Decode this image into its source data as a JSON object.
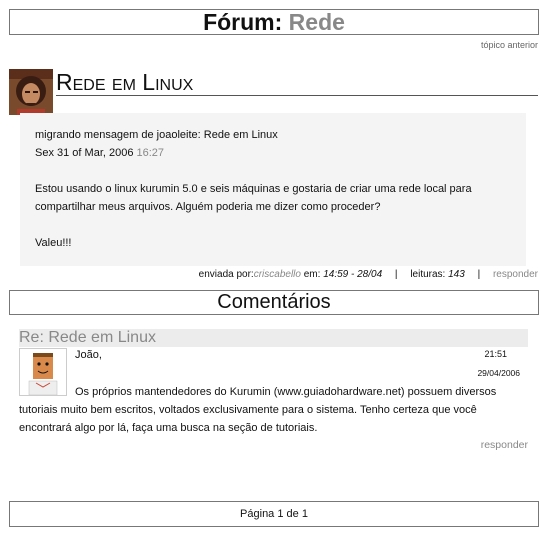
{
  "header": {
    "prefix": "Fórum:",
    "section": "Rede"
  },
  "nav": {
    "prev_topic": "tópico anterior"
  },
  "topic": {
    "title": "Rede em Linux",
    "migrated": "migrando mensagem de joaoleite: Rede em Linux",
    "date": "Sex 31 of Mar, 2006",
    "time": "16:27",
    "body": "Estou usando o linux kurumin 5.0 e seis máquinas e gostaria de criar uma rede local para compartilhar meus arquivos. Alguém poderia me dizer como proceder?",
    "signoff": "Valeu!!!"
  },
  "meta": {
    "sent_by_label": "enviada por:",
    "author": "criscabello",
    "at_label": "em:",
    "datetime": "14:59 - 28/04",
    "reads_label": "leituras:",
    "reads": "143",
    "reply": "responder"
  },
  "comments": {
    "header": "Comentários",
    "items": [
      {
        "title": "Re: Rede em Linux",
        "greeting": "João,",
        "time": "21:51",
        "date": "29/04/2006",
        "body": "Os próprios mantendedores do Kurumin (www.guiadohardware.net) possuem diversos tutoriais muito bem escritos, voltados exclusivamente para o sistema. Tenho certeza que você encontrará algo por lá, faça uma busca na seção de tutoriais.",
        "reply": "responder"
      }
    ]
  },
  "pager": {
    "label": "Página 1 de 1"
  }
}
